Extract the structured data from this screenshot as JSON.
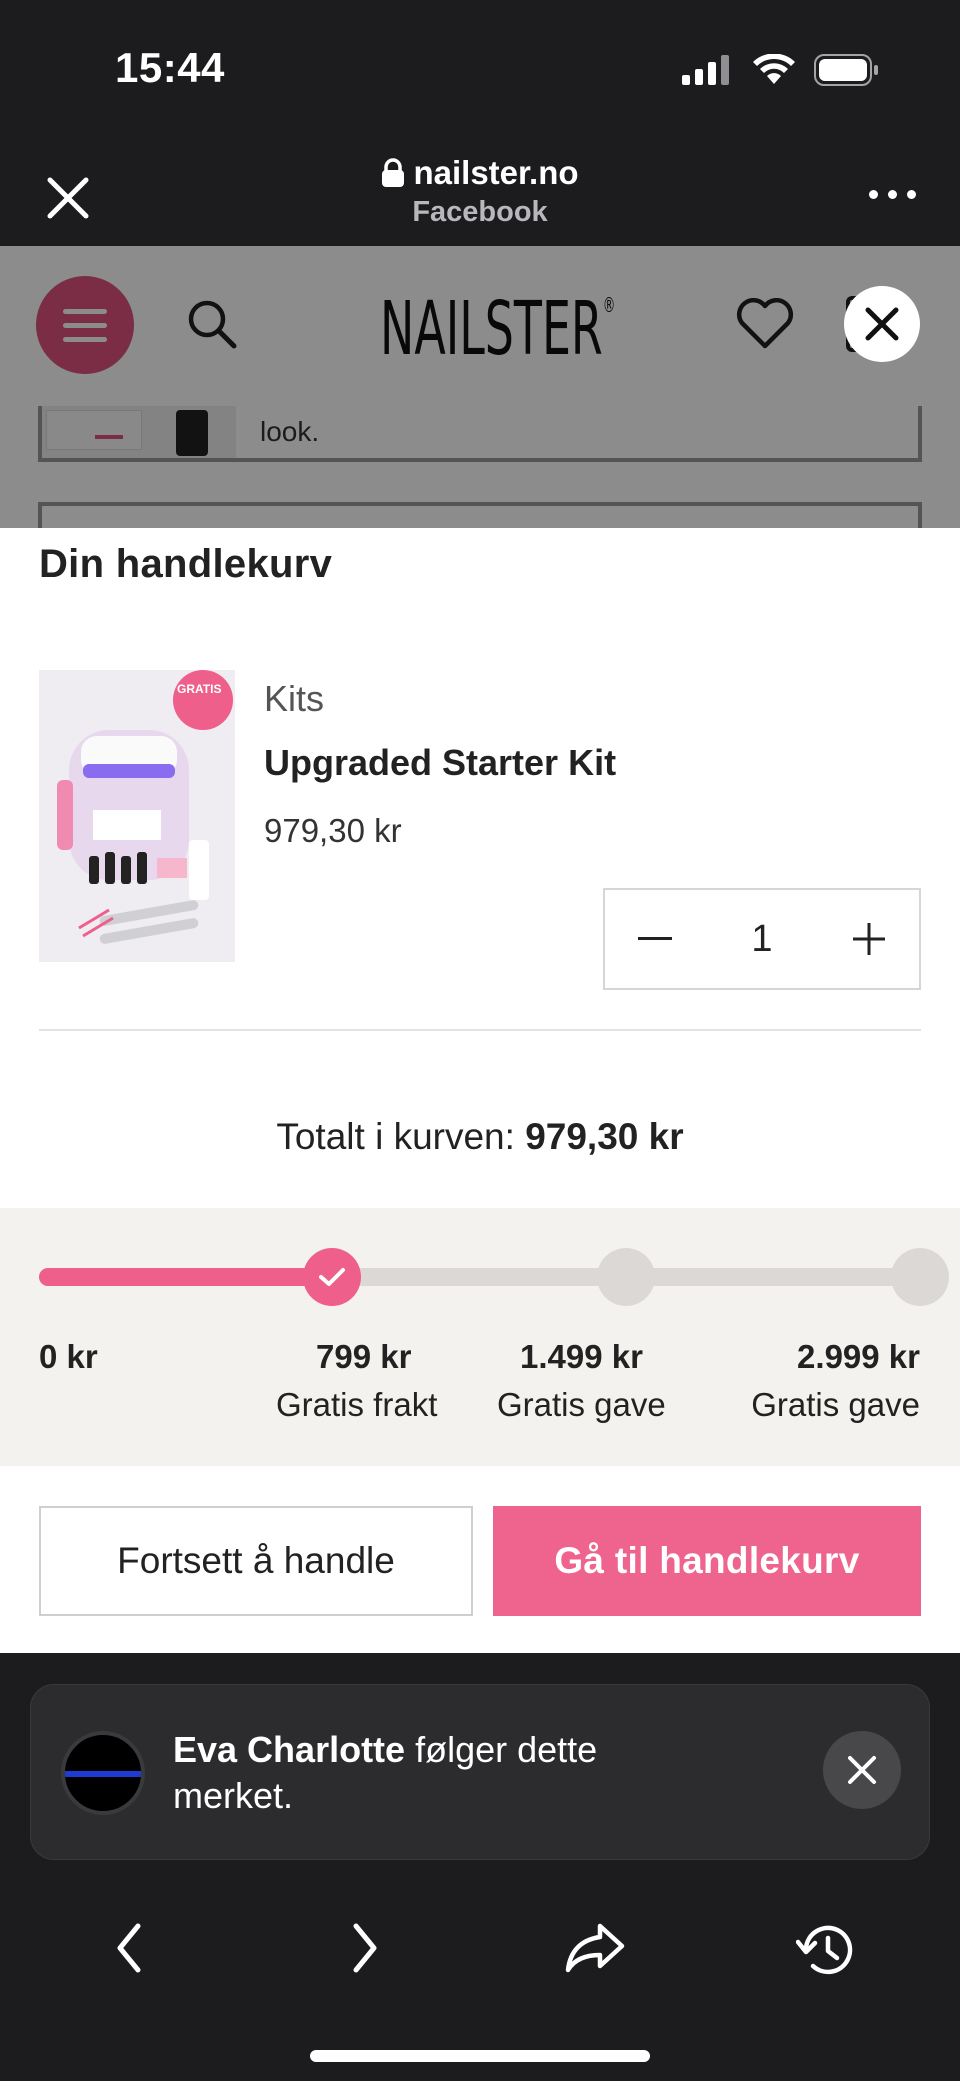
{
  "status_bar": {
    "time": "15:44"
  },
  "browser": {
    "url": "nailster.no",
    "source": "Facebook"
  },
  "site": {
    "logo": "NAILSTER",
    "logo_mark": "®",
    "card_text": "look."
  },
  "cart": {
    "title": "Din handlekurv",
    "item": {
      "category": "Kits",
      "name": "Upgraded Starter Kit",
      "price": "979,30 kr",
      "quantity": "1",
      "image_badge": "GRATIS"
    },
    "total_label": "Totalt i kurven: ",
    "total_value": "979,30 kr",
    "progress": {
      "fraction": 0.31,
      "milestones": [
        {
          "amount": "0 kr",
          "label": "",
          "reached": true
        },
        {
          "amount": "799 kr",
          "label": "Gratis frakt",
          "reached": true
        },
        {
          "amount": "1.499 kr",
          "label": "Gratis gave",
          "reached": false
        },
        {
          "amount": "2.999 kr",
          "label": "Gratis gave",
          "reached": false
        }
      ]
    },
    "continue_label": "Fortsett å handle",
    "checkout_label": "Gå til handlekurv"
  },
  "toast": {
    "name": "Eva Charlotte",
    "message_line1": " følger dette",
    "message_line2": "merket."
  },
  "colors": {
    "accent": "#ef648f",
    "dark": "#1c1c1e"
  }
}
